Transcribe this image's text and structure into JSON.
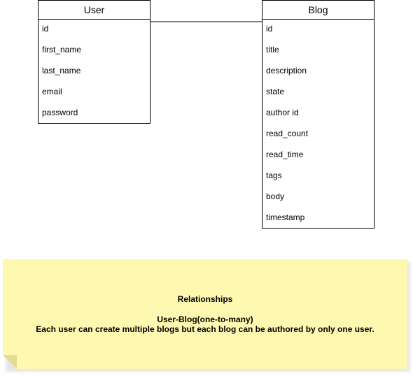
{
  "entities": {
    "user": {
      "title": "User",
      "fields": [
        "id",
        "first_name",
        "last_name",
        "email",
        "password"
      ]
    },
    "blog": {
      "title": "Blog",
      "fields": [
        "id",
        "title",
        "description",
        "state",
        "author id",
        "read_count",
        "read_time",
        "tags",
        "body",
        "timestamp"
      ]
    }
  },
  "note": {
    "title": "Relationships",
    "relationship": "User-Blog(one-to-many)",
    "description": "Each user can create multiple blogs but each blog can be authored by only one user."
  },
  "colors": {
    "border": "#000000",
    "note_fill": "#fff8b0",
    "note_fold": "#e3dc92",
    "background": "#ffffff"
  }
}
